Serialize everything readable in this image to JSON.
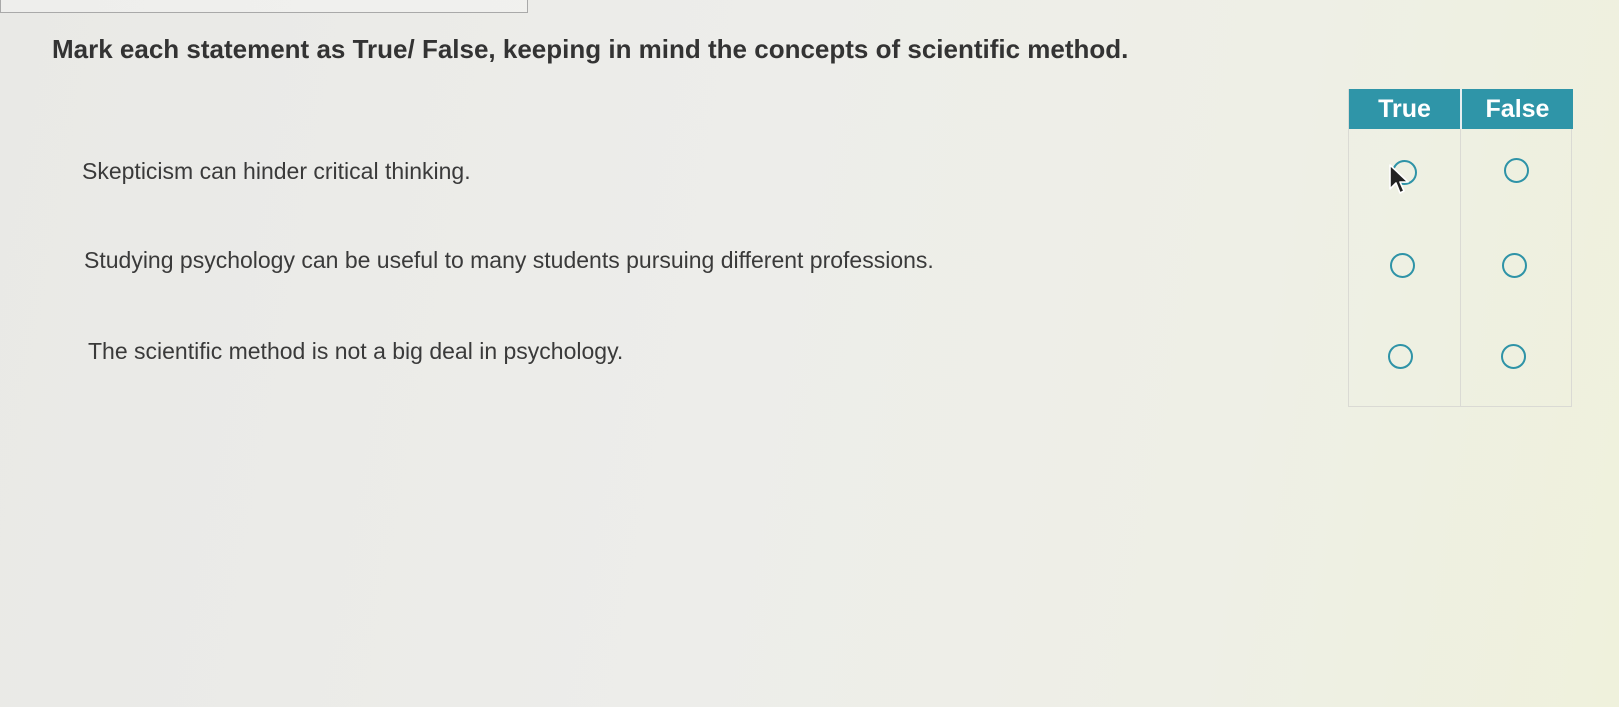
{
  "question": {
    "prompt": "Mark each statement as True/ False, keeping in mind the concepts of scientific method."
  },
  "table": {
    "headers": {
      "true_label": "True",
      "false_label": "False"
    },
    "accent_color": "#2f95a8",
    "rows": [
      {
        "statement": "Skepticism can hinder critical thinking.",
        "selected": null
      },
      {
        "statement": "Studying psychology can be useful to many students pursuing different professions.",
        "selected": null
      },
      {
        "statement": "The scientific method is not a big deal in psychology.",
        "selected": null
      }
    ]
  },
  "icons": {
    "cursor": "mouse-pointer-icon",
    "radio": "radio-button-icon"
  }
}
